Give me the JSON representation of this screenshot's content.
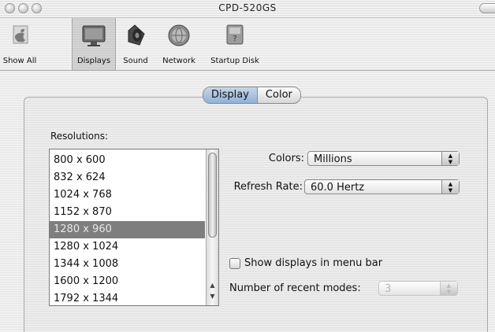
{
  "window": {
    "title": "CPD-520GS"
  },
  "toolbar": {
    "items": [
      {
        "label": "Show All",
        "icon": "apple-icon"
      },
      {
        "label": "Displays",
        "icon": "display-icon"
      },
      {
        "label": "Sound",
        "icon": "speaker-icon"
      },
      {
        "label": "Network",
        "icon": "globe-icon"
      },
      {
        "label": "Startup Disk",
        "icon": "disk-icon"
      }
    ],
    "selected": "Displays"
  },
  "tabs": [
    {
      "label": "Display",
      "active": true
    },
    {
      "label": "Color",
      "active": false
    }
  ],
  "resolutions": {
    "label": "Resolutions:",
    "items": [
      "800 x 600",
      "832 x 624",
      "1024 x 768",
      "1152 x 870",
      "1280 x 960",
      "1280 x 1024",
      "1344 x 1008",
      "1600 x 1200",
      "1792 x 1344"
    ],
    "selected": "1280 x 960"
  },
  "colors": {
    "label": "Colors:",
    "value": "Millions"
  },
  "refresh_rate": {
    "label": "Refresh Rate:",
    "value": "60.0 Hertz"
  },
  "show_in_menu_bar": {
    "label": "Show displays in menu bar",
    "checked": false
  },
  "recent_modes": {
    "label": "Number of recent modes:",
    "value": "3",
    "enabled": false
  },
  "colors_palette": {
    "selection": "#7e7e7e",
    "tab_active": "#8fb0d6"
  }
}
